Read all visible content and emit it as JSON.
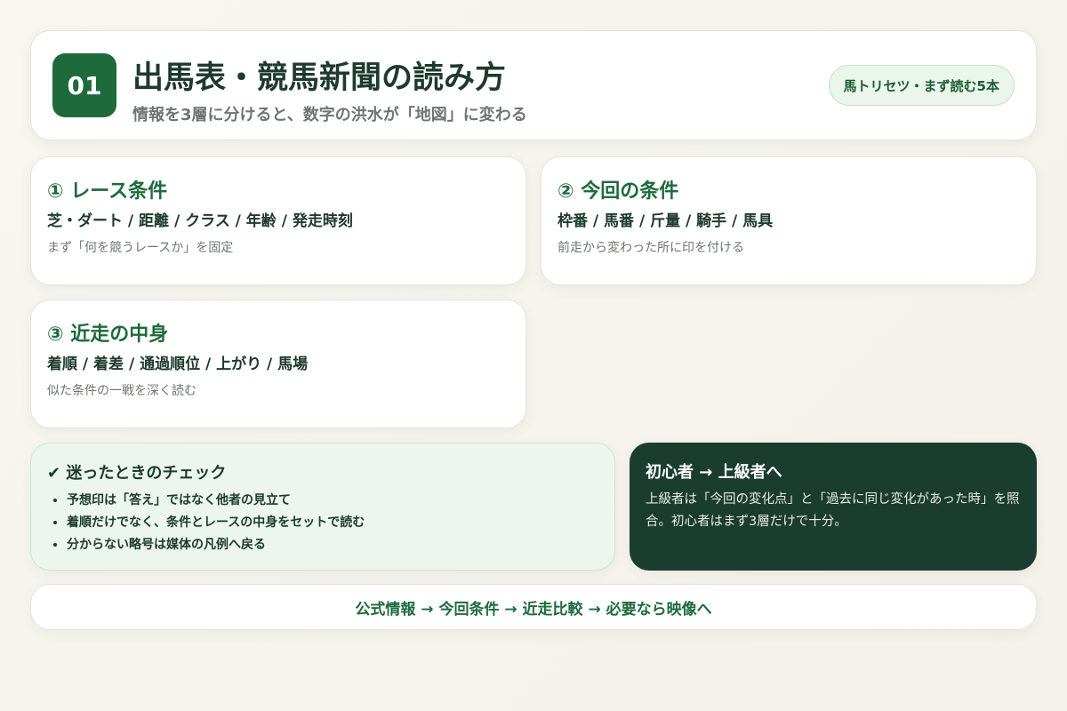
{
  "header": {
    "number": "01",
    "title": "出馬表・競馬新聞の読み方",
    "subtitle": "情報を3層に分けると、数字の洪水が「地図」に変わる",
    "tag": "馬トリセツ・まず読む5本"
  },
  "sections": [
    {
      "title": "① レース条件",
      "items": "芝・ダート / 距離 / クラス / 年齢 / 発走時刻",
      "note": "まず「何を競うレースか」を固定"
    },
    {
      "title": "② 今回の条件",
      "items": "枠番 / 馬番 / 斤量 / 騎手 / 馬具",
      "note": "前走から変わった所に印を付ける"
    },
    {
      "title": "③ 近走の中身",
      "items": "着順 / 着差 / 通過順位 / 上がり / 馬場",
      "note": "似た条件の一戦を深く読む"
    }
  ],
  "check": {
    "title": "✔ 迷ったときのチェック",
    "items": [
      "予想印は「答え」ではなく他者の見立て",
      "着順だけでなく、条件とレースの中身をセットで読む",
      "分からない略号は媒体の凡例へ戻る"
    ]
  },
  "advanced": {
    "title": "初心者 → 上級者へ",
    "body": "上級者は「今回の変化点」と「過去に同じ変化があった時」を照合。初心者はまず3層だけで十分。"
  },
  "footer": {
    "text": "公式情報 → 今回条件 → 近走比較 → 必要なら映像へ"
  },
  "colors": {
    "accent": "#1e6a3b",
    "dark_card": "#1b3d30",
    "check_bg": "#ecf6ee"
  }
}
